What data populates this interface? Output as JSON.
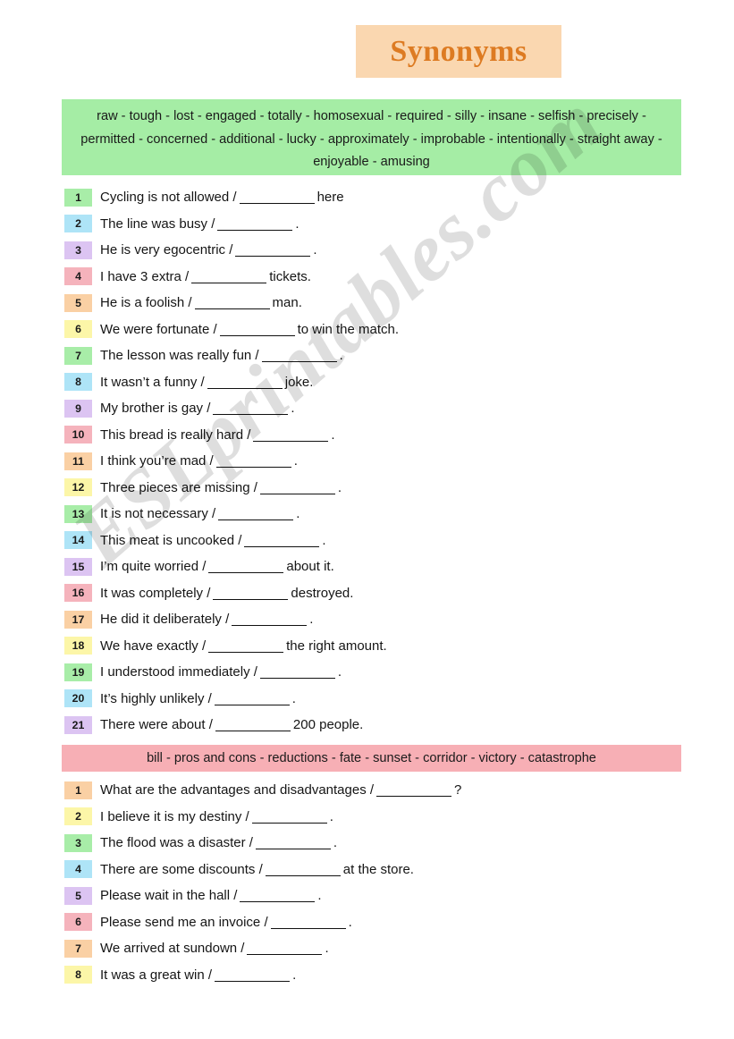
{
  "title": {
    "text": "Synonyms",
    "background_color": "#fad7b0",
    "text_color": "#dd7b22"
  },
  "watermark": {
    "text": "ESLprintables.com"
  },
  "palette": {
    "green": "#a8eda8",
    "blue": "#aee4f7",
    "purple": "#dcc4f2",
    "pink": "#f5b3bc",
    "orange": "#fad0a4",
    "yellow": "#fcf6a8",
    "wordbank_1_background": "#a5eda5",
    "wordbank_2_background": "#f7afb5"
  },
  "wordbank_1": {
    "text": "raw - tough - lost - engaged - totally - homosexual - required - silly - insane - selfish - precisely - permitted - concerned - additional - lucky - approximately - improbable - intentionally - straight away - enjoyable - amusing",
    "words": [
      "raw",
      "tough",
      "lost",
      "engaged",
      "totally",
      "homosexual",
      "required",
      "silly",
      "insane",
      "selfish",
      "precisely",
      "permitted",
      "concerned",
      "additional",
      "lucky",
      "approximately",
      "improbable",
      "intentionally",
      "straight away",
      "enjoyable",
      "amusing"
    ]
  },
  "wordbank_2": {
    "text": "bill - pros and cons - reductions - fate - sunset - corridor - victory - catastrophe",
    "words": [
      "bill",
      "pros and cons",
      "reductions",
      "fate",
      "sunset",
      "corridor",
      "victory",
      "catastrophe"
    ]
  },
  "exercises_1": [
    {
      "number": "1",
      "color": "green",
      "before": "Cycling is not allowed /",
      "after": "here"
    },
    {
      "number": "2",
      "color": "blue",
      "before": "The line was busy /",
      "after": "."
    },
    {
      "number": "3",
      "color": "purple",
      "before": "He is very egocentric /",
      "after": "."
    },
    {
      "number": "4",
      "color": "pink",
      "before": "I have 3 extra /",
      "after": "tickets."
    },
    {
      "number": "5",
      "color": "orange",
      "before": "He is a foolish /",
      "after": "man."
    },
    {
      "number": "6",
      "color": "yellow",
      "before": "We were fortunate /",
      "after": "to win the match."
    },
    {
      "number": "7",
      "color": "green",
      "before": "The lesson was really fun /",
      "after": "."
    },
    {
      "number": "8",
      "color": "blue",
      "before": "It wasn’t a funny /",
      "after": "joke."
    },
    {
      "number": "9",
      "color": "purple",
      "before": "My brother is gay /",
      "after": "."
    },
    {
      "number": "10",
      "color": "pink",
      "before": "This bread is really hard /",
      "after": "."
    },
    {
      "number": "11",
      "color": "orange",
      "before": "I think you’re mad /",
      "after": "."
    },
    {
      "number": "12",
      "color": "yellow",
      "before": "Three pieces are missing /",
      "after": "."
    },
    {
      "number": "13",
      "color": "green",
      "before": "It is not necessary /",
      "after": "."
    },
    {
      "number": "14",
      "color": "blue",
      "before": "This meat is uncooked /",
      "after": "."
    },
    {
      "number": "15",
      "color": "purple",
      "before": "I’m quite worried /",
      "after": "about it."
    },
    {
      "number": "16",
      "color": "pink",
      "before": "It was completely /",
      "after": "destroyed."
    },
    {
      "number": "17",
      "color": "orange",
      "before": "He did it deliberately /",
      "after": "."
    },
    {
      "number": "18",
      "color": "yellow",
      "before": "We have exactly /",
      "after": "the right amount."
    },
    {
      "number": "19",
      "color": "green",
      "before": "I understood immediately /",
      "after": "."
    },
    {
      "number": "20",
      "color": "blue",
      "before": "It’s highly unlikely /",
      "after": "."
    },
    {
      "number": "21",
      "color": "purple",
      "before": "There were about /",
      "after": "200 people."
    }
  ],
  "exercises_2": [
    {
      "number": "1",
      "color": "orange",
      "before": "What are the advantages and disadvantages /",
      "after": "?"
    },
    {
      "number": "2",
      "color": "yellow",
      "before": "I believe it is my destiny /",
      "after": "."
    },
    {
      "number": "3",
      "color": "green",
      "before": "The flood was a disaster /",
      "after": "."
    },
    {
      "number": "4",
      "color": "blue",
      "before": "There are some discounts /",
      "after": "at the store."
    },
    {
      "number": "5",
      "color": "purple",
      "before": "Please wait in the hall /",
      "after": "."
    },
    {
      "number": "6",
      "color": "pink",
      "before": "Please send me an invoice /",
      "after": "."
    },
    {
      "number": "7",
      "color": "orange",
      "before": "We arrived at sundown /",
      "after": "."
    },
    {
      "number": "8",
      "color": "yellow",
      "before": "It was a great win /",
      "after": "."
    }
  ]
}
